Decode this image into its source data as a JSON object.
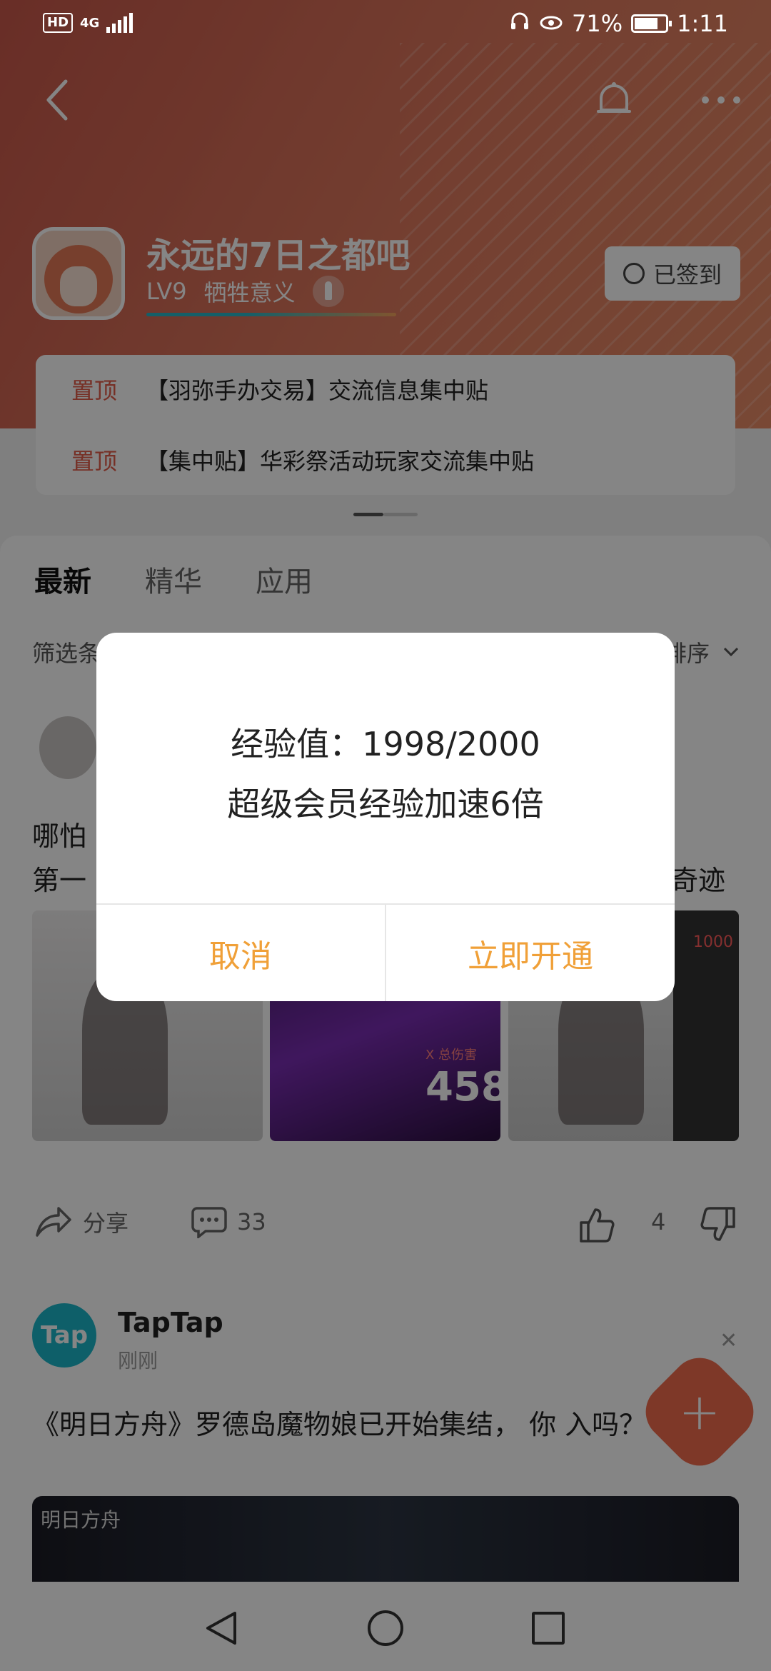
{
  "status": {
    "hd": "HD",
    "network": "4G",
    "battery": "71%",
    "time": "1:11"
  },
  "forum": {
    "title": "永远的7日之都吧",
    "level": "LV9",
    "level_title": "牺牲意义",
    "signed_label": "已签到"
  },
  "pinned": [
    {
      "tag": "置顶",
      "text": "【羽弥手办交易】交流信息集中贴"
    },
    {
      "tag": "置顶",
      "text": "【集中贴】华彩祭活动玩家交流集中贴"
    }
  ],
  "tabs": [
    {
      "label": "最新"
    },
    {
      "label": "精华"
    },
    {
      "label": "应用"
    }
  ],
  "filter": {
    "label": "筛选条",
    "sort_label": "排序"
  },
  "post": {
    "text_line1": "哪怕",
    "text_line2": "第一",
    "text_tail": "奇迹",
    "image2_tag": "X 总伤害",
    "image2_value": "458",
    "image3_label": "1000",
    "share": "分享",
    "comments": "33",
    "likes": "4"
  },
  "feed2": {
    "logo": "Tap",
    "name": "TapTap",
    "time": "刚刚",
    "text": "《明日方舟》罗德岛魔物娘已开始集结， 你 入吗？",
    "banner_title": "明日方舟"
  },
  "dialog": {
    "line1": "经验值：1998/2000",
    "line2": "超级会员经验加速6倍",
    "cancel": "取消",
    "confirm": "立即开通"
  },
  "colors": {
    "accent": "#f0a038",
    "header": "#df7a5e",
    "pinned_tag": "#e35d4a",
    "taptap": "#1bb7c9",
    "fab": "#f26b4e"
  },
  "icons": [
    "back-icon",
    "bell-icon",
    "more-icon",
    "sign-icon",
    "rocket-icon",
    "chevron-down-icon",
    "share-icon",
    "comment-icon",
    "thumb-up-icon",
    "thumb-down-icon",
    "close-icon",
    "plus-icon",
    "nav-back-icon",
    "nav-home-icon",
    "nav-recent-icon"
  ]
}
